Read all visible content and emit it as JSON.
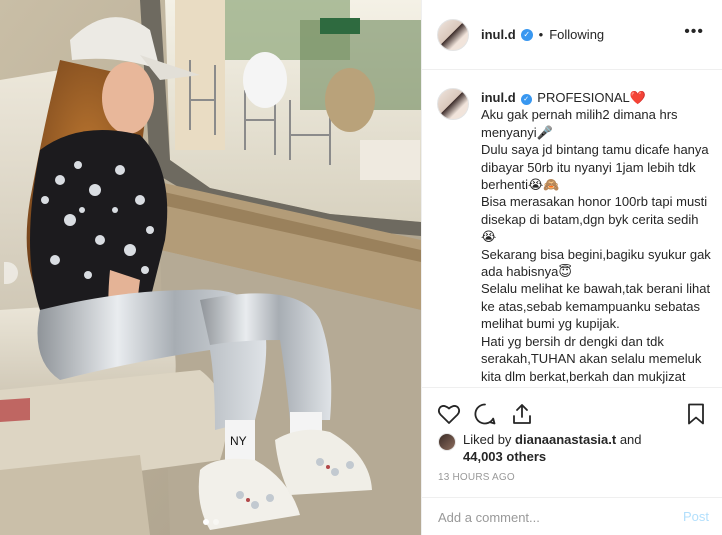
{
  "post": {
    "username": "inul.d",
    "separator": "•",
    "follow_state": "Following",
    "more_icon": "more-horizontal-icon",
    "caption": {
      "username": "inul.d",
      "text": " PROFESIONAL❤️\nAku gak pernah milih2 dimana hrs menyanyi🎤\nDulu saya jd bintang tamu dicafe hanya dibayar 50rb itu nyanyi 1jam lebih tdk berhenti😭🙈\nBisa merasakan honor 100rb tapi musti disekap di batam,dgn byk cerita sedih😭\nSekarang bisa begini,bagiku syukur gak ada habisnya😇\nSelalu melihat ke bawah,tak berani lihat ke atas,sebab kemampuanku sebatas melihat bumi yg kupijak.\nHati yg bersih dr dengki dan tdk serakah,TUHAN akan selalu memeluk kita dlm berkat,berkah dan mukjizat rezeki yg tiada henti.\nDimana aku di undang utk menghibur"
    },
    "actions": {
      "like": "heart-icon",
      "comment": "comment-icon",
      "share": "share-icon",
      "save": "bookmark-icon"
    },
    "likes": {
      "prefix": "Liked by ",
      "user": "dianaanastasia.t",
      "and": " and",
      "count": "44,003 others"
    },
    "time": "13 HOURS AGO",
    "comment_placeholder": "Add a comment...",
    "post_label": "Post",
    "carousel": {
      "total": 2,
      "active": 1
    },
    "colors": {
      "link": "#3897f0",
      "muted": "#999999",
      "post_disabled": "#b2dffc",
      "border": "#efefef"
    }
  }
}
